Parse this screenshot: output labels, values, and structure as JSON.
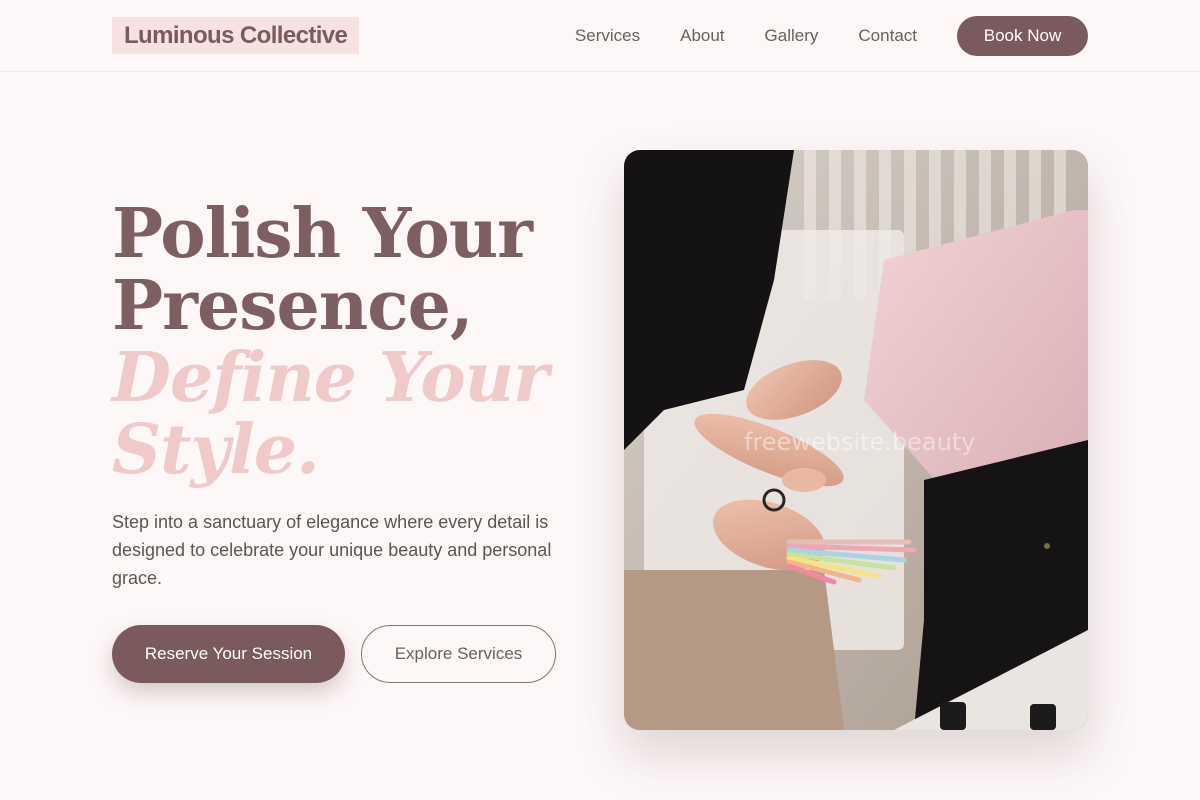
{
  "header": {
    "logo": "Luminous Collective",
    "nav": [
      "Services",
      "About",
      "Gallery",
      "Contact"
    ],
    "cta": "Book Now"
  },
  "hero": {
    "title_line1": "Polish Your",
    "title_line2": "Presence,",
    "title_line3": "Define Your",
    "title_line4": "Style.",
    "subtitle": "Step into a sanctuary of elegance where every detail is designed to celebrate your unique beauty and personal grace.",
    "primary_button": "Reserve Your Session",
    "secondary_button": "Explore Services",
    "watermark": "freewebsite.beauty"
  },
  "colors": {
    "background": "#fdf7f7",
    "accent": "#7b5a5d",
    "accent_light": "#f0c9c9",
    "logo_highlight": "#f8e1e1"
  }
}
